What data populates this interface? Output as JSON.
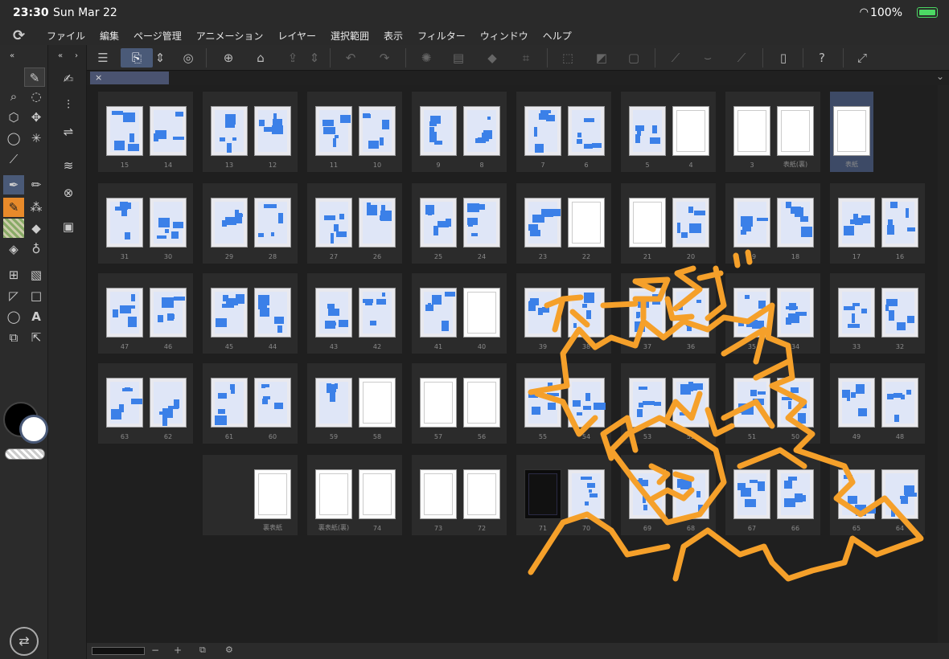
{
  "status": {
    "time": "23:30",
    "date": "Sun Mar 22",
    "battery": "100%"
  },
  "menu": [
    "ファイル",
    "編集",
    "ページ管理",
    "アニメーション",
    "レイヤー",
    "選択範囲",
    "表示",
    "フィルター",
    "ウィンドウ",
    "ヘルプ"
  ],
  "toolbar_icons": [
    "menu-icon",
    "edit-page-icon",
    "chevron-updown-icon",
    "spiral-icon",
    "new-page-icon",
    "open-folder-icon",
    "export-icon",
    "chevron-updown-icon",
    "undo-icon",
    "redo-icon",
    "loading-icon",
    "transform-icon",
    "fill-icon",
    "crop-icon",
    "deselect-icon",
    "invert-icon",
    "border-icon",
    "ruler-icon",
    "brush-icon",
    "pen-icon",
    "device-icon",
    "help-icon",
    "fullscreen-icon"
  ],
  "tab": {
    "close": "×"
  },
  "pages": [
    [
      "15",
      "14",
      "13",
      "12",
      "11",
      "10",
      "9",
      "8",
      "7",
      "6",
      "5",
      "4",
      "3",
      "表紙(裏)",
      "表紙"
    ],
    [
      "31",
      "30",
      "29",
      "28",
      "27",
      "26",
      "25",
      "24",
      "23",
      "22",
      "21",
      "20",
      "19",
      "18",
      "17",
      "16"
    ],
    [
      "47",
      "46",
      "45",
      "44",
      "43",
      "42",
      "41",
      "40",
      "39",
      "38",
      "37",
      "36",
      "35",
      "34",
      "33",
      "32"
    ],
    [
      "63",
      "62",
      "61",
      "60",
      "59",
      "58",
      "57",
      "56",
      "55",
      "54",
      "53",
      "52",
      "51",
      "50",
      "49",
      "48"
    ],
    [
      "裏表紙",
      "裏表紙(裏)",
      "74",
      "73",
      "72",
      "71",
      "70",
      "69",
      "68",
      "67",
      "66",
      "65",
      "64"
    ]
  ],
  "doodle_text": "ネーム完成!!",
  "colors": {
    "accent": "#4a5a78",
    "doodle": "#f5a02a",
    "page_blue": "#3b80e8"
  },
  "bottom": {
    "minus": "−",
    "plus": "+"
  }
}
